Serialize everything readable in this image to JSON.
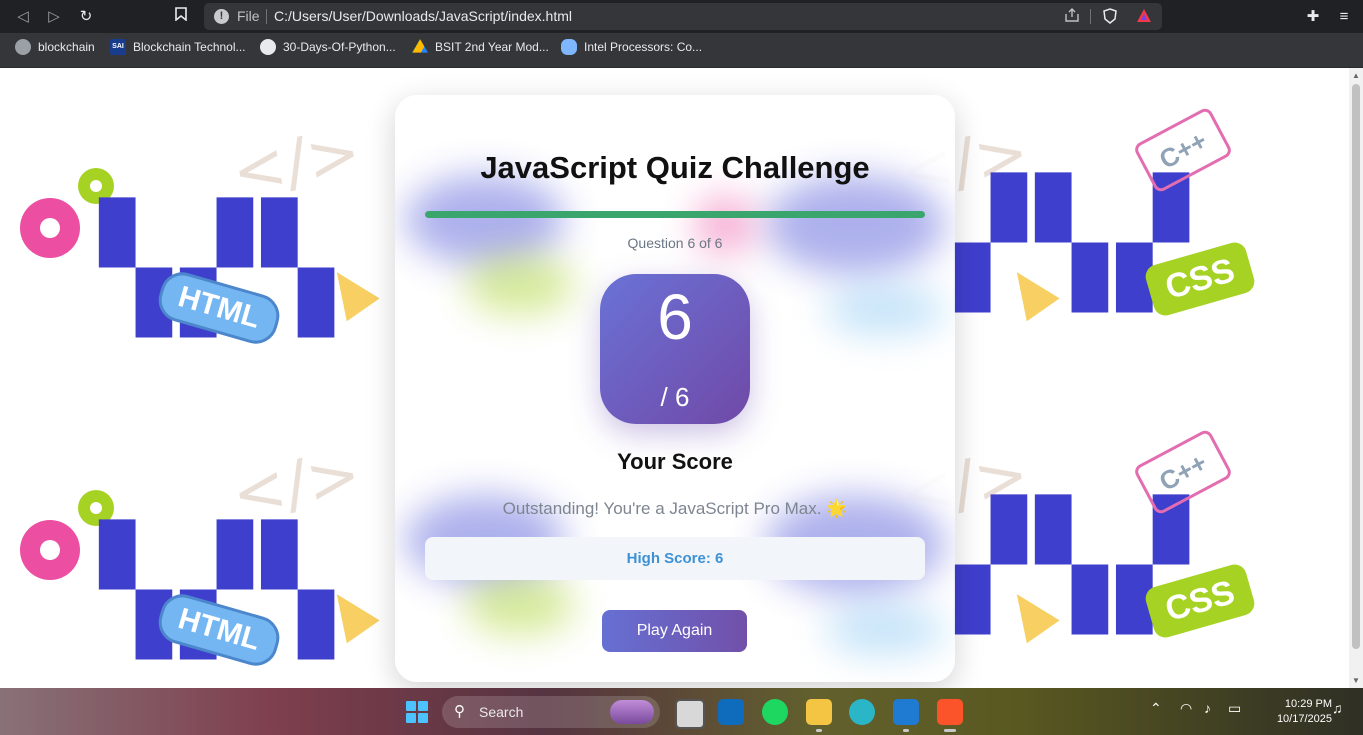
{
  "browser": {
    "scheme_label": "File",
    "url": "C:/Users/User/Downloads/JavaScript/index.html",
    "bookmarks": [
      {
        "label": "blockchain",
        "icon": "globe-icon"
      },
      {
        "label": "Blockchain Technol...",
        "icon": "sai-icon",
        "icon_text": "SAI"
      },
      {
        "label": "30-Days-Of-Python...",
        "icon": "github-icon"
      },
      {
        "label": "BSIT 2nd Year Mod...",
        "icon": "google-drive-icon"
      },
      {
        "label": "Intel Processors: Co...",
        "icon": "cloud-icon"
      }
    ]
  },
  "background": {
    "html_badge": "HTML",
    "css_badge": "CSS",
    "cpp_badge": "C++",
    "code_tag": "</>"
  },
  "quiz": {
    "title": "JavaScript Quiz Challenge",
    "progress_fraction": 1.0,
    "question_counter": "Question 6 of 6",
    "score": "6",
    "score_total": "/ 6",
    "score_label": "Your Score",
    "message": "Outstanding! You're a JavaScript Pro Max. 🌟",
    "high_score": "High Score: 6",
    "play_again_label": "Play Again"
  },
  "taskbar": {
    "search_label": "Search",
    "time": "10:29 PM",
    "date": "10/17/2025"
  },
  "colors": {
    "progress": "#3aa56c",
    "score_gradient_start": "#6a72d6",
    "score_gradient_end": "#7049a7",
    "high_score_text": "#3d91d4",
    "browser_chrome": "#202124"
  }
}
